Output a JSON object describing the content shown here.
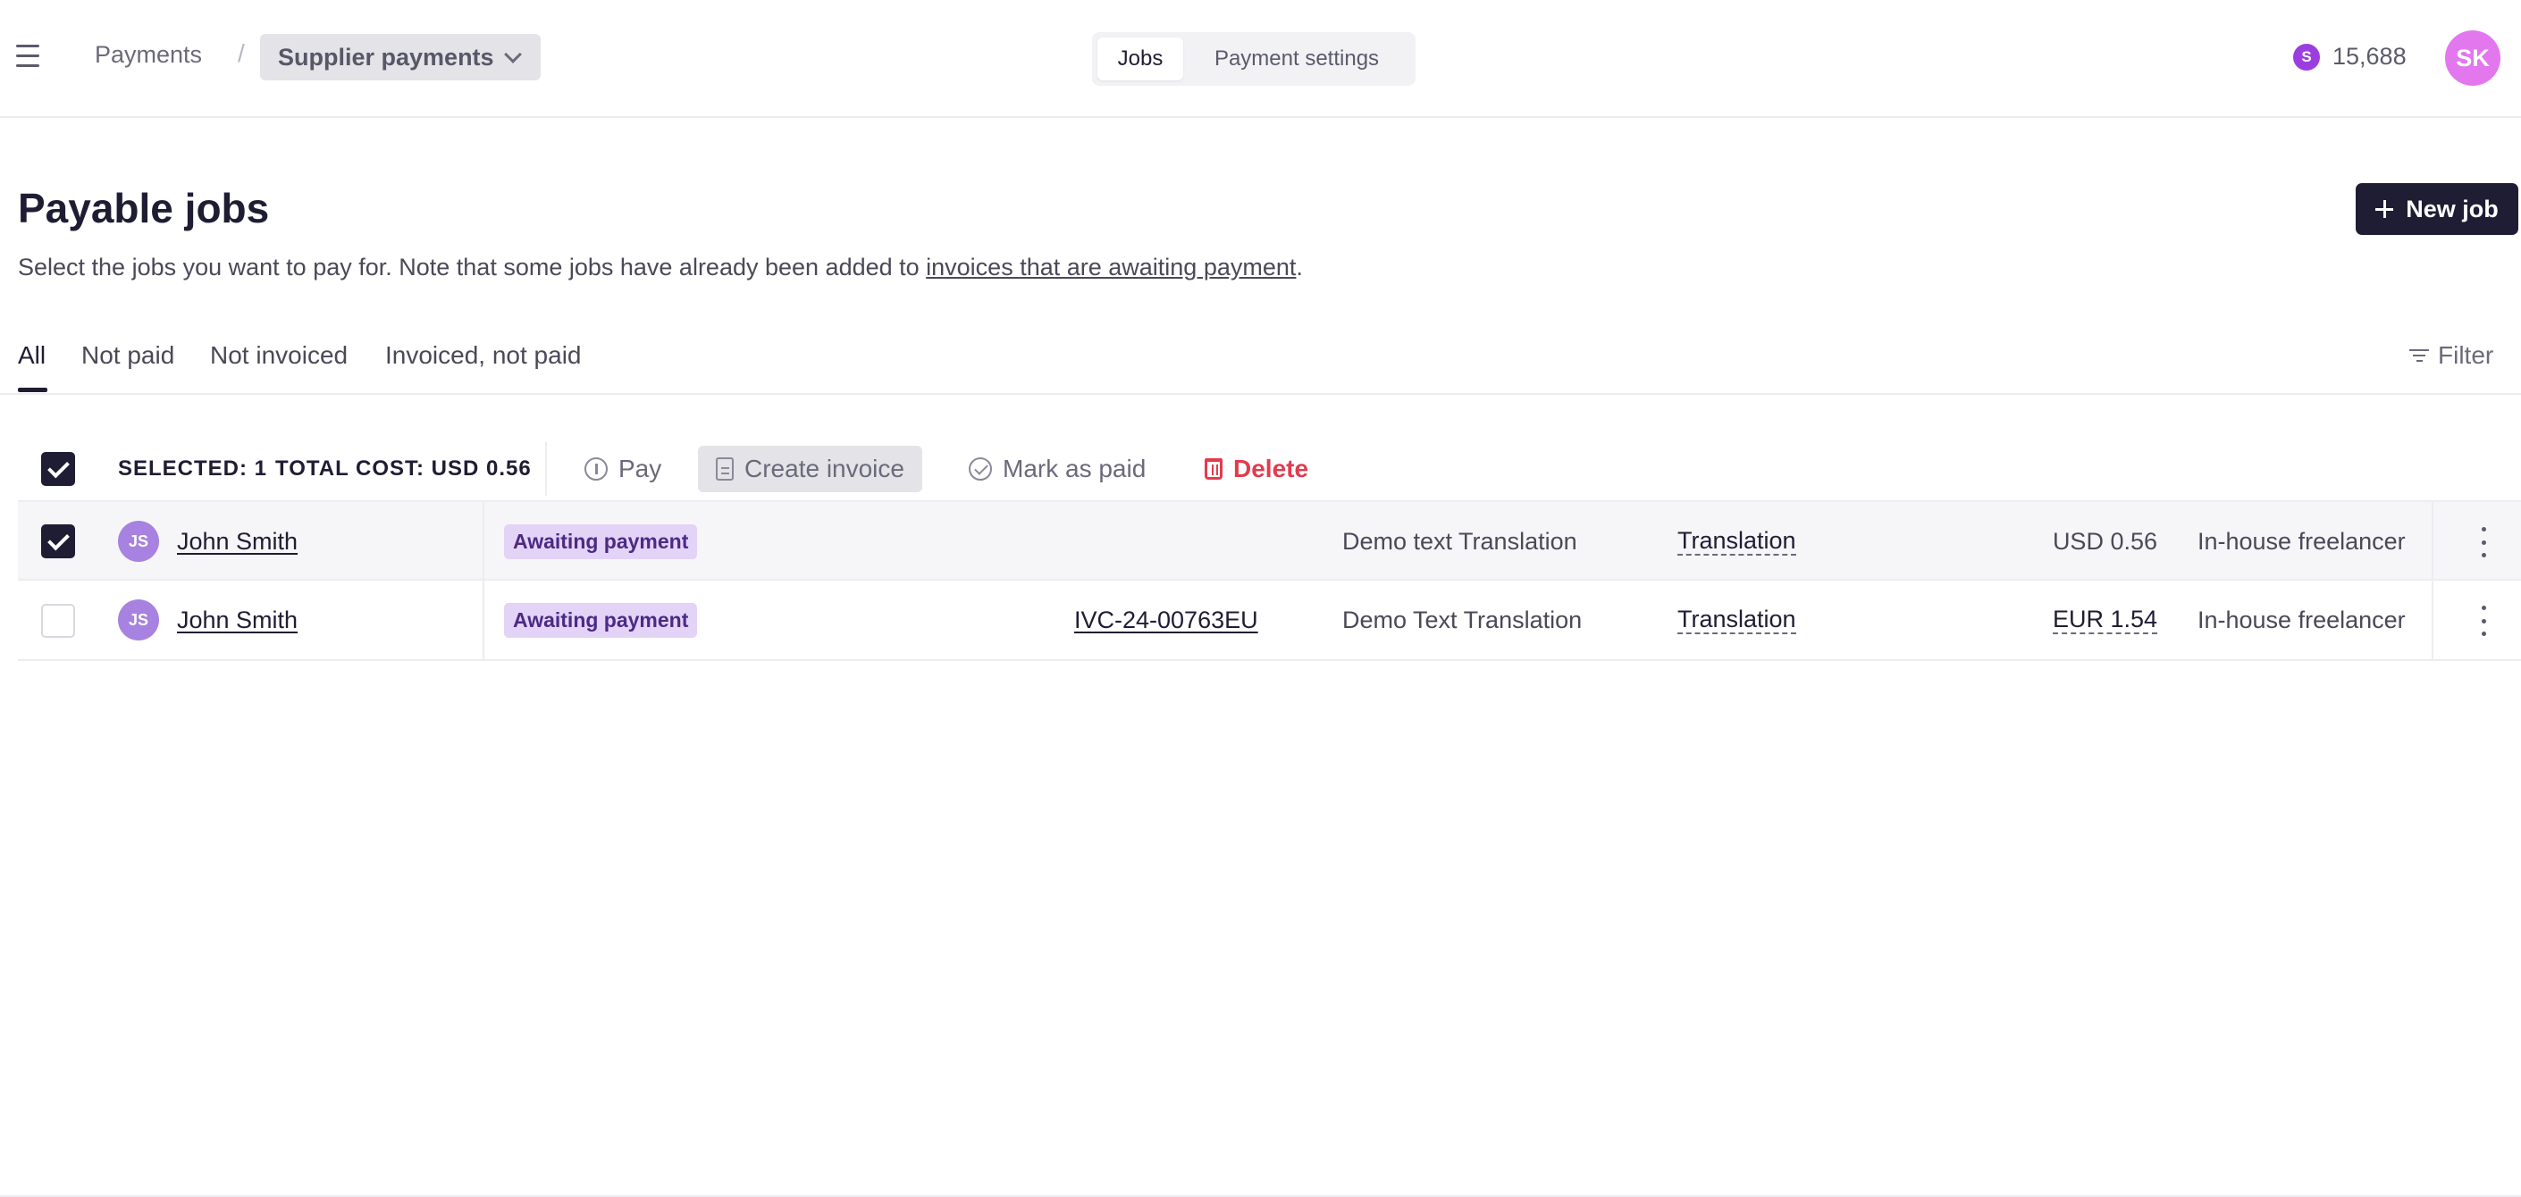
{
  "header": {
    "breadcrumb_root": "Payments",
    "breadcrumb_sep": "/",
    "breadcrumb_current": "Supplier payments",
    "tabs": [
      "Jobs",
      "Payment settings"
    ],
    "credits_icon": "S",
    "credits_value": "15,688",
    "avatar_initials": "SK",
    "colors": {
      "credit": "#9b3ee0",
      "avatar": "#e277ee"
    }
  },
  "page": {
    "title": "Payable jobs",
    "new_job_label": "New job",
    "subtitle_before": "Select the jobs you want to pay for. Note that some jobs have already been added to ",
    "subtitle_link": "invoices that are awaiting payment",
    "subtitle_after": "."
  },
  "filter_tabs": {
    "items": [
      "All",
      "Not paid",
      "Not invoiced",
      "Invoiced, not paid"
    ],
    "active": "All",
    "filter_label": "Filter"
  },
  "toolbar": {
    "selected": "SELECTED: 1",
    "total_cost": "TOTAL COST: USD 0.56",
    "pay_label": "Pay",
    "create_invoice_label": "Create invoice",
    "mark_paid_label": "Mark as paid",
    "delete_label": "Delete",
    "colors": {
      "danger": "#e23b4e",
      "primary": "#1f1d33"
    }
  },
  "rows": [
    {
      "selected": true,
      "initials": "JS",
      "name": "John Smith",
      "status": "Awaiting payment",
      "invoice": "",
      "job_name": "Demo text Translation",
      "service": "Translation",
      "amount": "USD 0.56",
      "vendor_type": "In-house freelancer"
    },
    {
      "selected": false,
      "initials": "JS",
      "name": "John Smith",
      "status": "Awaiting payment",
      "invoice": "IVC-24-00763EU",
      "job_name": "Demo Text Translation",
      "service": "Translation",
      "amount": "EUR 1.54",
      "vendor_type": "In-house freelancer"
    }
  ],
  "icons": {
    "menu": "hamburger-icon",
    "chevron": "chevron-down-icon",
    "plus": "plus-icon",
    "filter": "filter-icon",
    "pay": "coin-icon",
    "invoice": "document-icon",
    "mark_paid": "check-circle-icon",
    "delete": "trash-icon",
    "more": "kebab-icon"
  }
}
